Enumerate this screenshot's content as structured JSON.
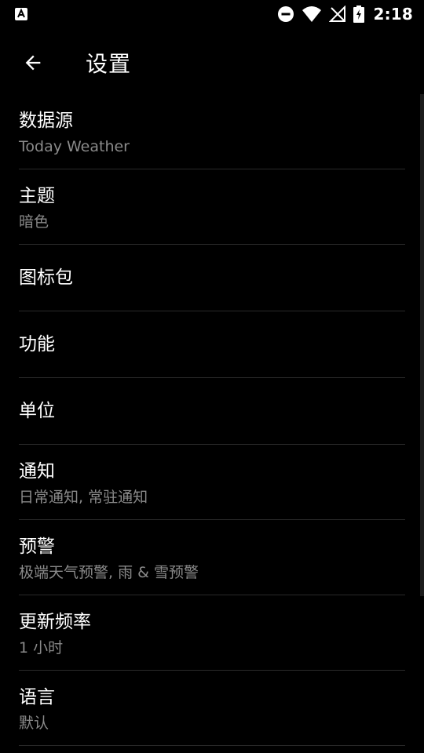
{
  "status_bar": {
    "time": "2:18",
    "icons": [
      "app-notification-icon",
      "do-not-disturb-icon",
      "wifi-icon",
      "no-signal-icon",
      "battery-charging-icon"
    ]
  },
  "toolbar": {
    "title": "设置",
    "back_icon": "arrow-back-icon"
  },
  "settings": [
    {
      "title": "数据源",
      "summary": "Today Weather"
    },
    {
      "title": "主题",
      "summary": "暗色"
    },
    {
      "title": "图标包",
      "summary": ""
    },
    {
      "title": "功能",
      "summary": ""
    },
    {
      "title": "单位",
      "summary": ""
    },
    {
      "title": "通知",
      "summary": "日常通知, 常驻通知"
    },
    {
      "title": "预警",
      "summary": "极端天气预警, 雨 & 雪预警"
    },
    {
      "title": "更新频率",
      "summary": "1 小时"
    },
    {
      "title": "语言",
      "summary": "默认"
    }
  ],
  "colors": {
    "background": "#000000",
    "text_primary": "#ffffff",
    "text_secondary": "#8a8a8a",
    "divider": "#2a2a2a"
  }
}
